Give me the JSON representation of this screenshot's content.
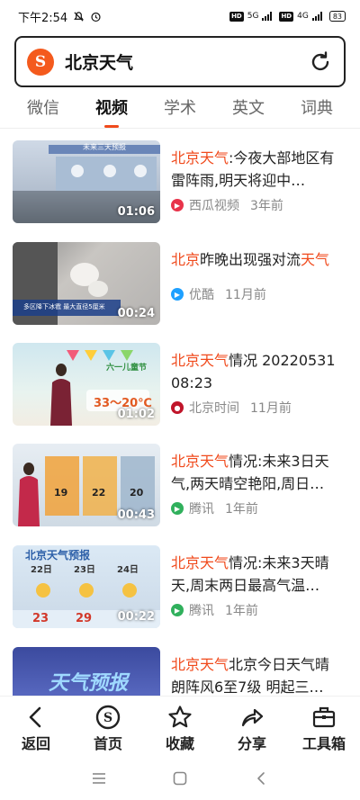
{
  "status_bar": {
    "time": "下午2:54",
    "net1": "5G",
    "net2": "4G",
    "battery": "83"
  },
  "search": {
    "logo_letter": "S",
    "query": "北京天气"
  },
  "tabs": [
    {
      "label": "微信",
      "active": false
    },
    {
      "label": "视频",
      "active": true
    },
    {
      "label": "学术",
      "active": false
    },
    {
      "label": "英文",
      "active": false
    },
    {
      "label": "词典",
      "active": false
    }
  ],
  "colors": {
    "accent": "#f04a1c",
    "logo": "#f45a1d"
  },
  "results": [
    {
      "title_hl": "北京天气",
      "title_rest": ":今夜大部地区有雷阵雨,明天将迎中…",
      "source": "西瓜视频",
      "source_icon": "xigua-icon",
      "source_color": "#e8334a",
      "age": "3年前",
      "duration": "01:06",
      "thumb_text": "未来三天预报"
    },
    {
      "title_pre": "",
      "title_hl": "北京",
      "title_mid": "昨晚出现强对流",
      "title_hl2": "天气",
      "source": "优酷",
      "source_icon": "youku-icon",
      "source_color": "#1ea0ff",
      "age": "11月前",
      "duration": "00:24",
      "thumb_text": "多区降下冰雹 最大直径5厘米"
    },
    {
      "title_hl": "北京天气",
      "title_rest": "情况 20220531 08:23",
      "source": "北京时间",
      "source_icon": "bjtime-icon",
      "source_color": "#c0152a",
      "age": "11月前",
      "duration": "01:02",
      "thumb_text": "33～20℃",
      "thumb_banner": "六一儿童节"
    },
    {
      "title_hl": "北京天气",
      "title_rest": "情况:未来3日天气,两天晴空艳阳,周日…",
      "source": "腾讯",
      "source_icon": "tencent-icon",
      "source_color": "#30b05c",
      "age": "1年前",
      "duration": "00:43",
      "thumb_nums": [
        "19",
        "22",
        "20"
      ]
    },
    {
      "title_hl": "北京天气",
      "title_rest": "情况:未来3天晴天,周末两日最高气温…",
      "source": "腾讯",
      "source_icon": "tencent-icon",
      "source_color": "#30b05c",
      "age": "1年前",
      "duration": "00:22",
      "thumb_text": "北京天气预报",
      "thumb_days": [
        "22日",
        "23日",
        "24日"
      ],
      "thumb_nums": [
        "23",
        "29",
        "29"
      ]
    },
    {
      "title_hl": "北京天气",
      "title_rest": "北京今日天气晴 朗阵风6至7级 明起三…",
      "thumb_text": "天气预报"
    }
  ],
  "bottom_nav": [
    {
      "label": "返回",
      "icon": "back-icon"
    },
    {
      "label": "首页",
      "icon": "home-logo-icon"
    },
    {
      "label": "收藏",
      "icon": "star-icon"
    },
    {
      "label": "分享",
      "icon": "share-icon"
    },
    {
      "label": "工具箱",
      "icon": "toolbox-icon"
    }
  ]
}
